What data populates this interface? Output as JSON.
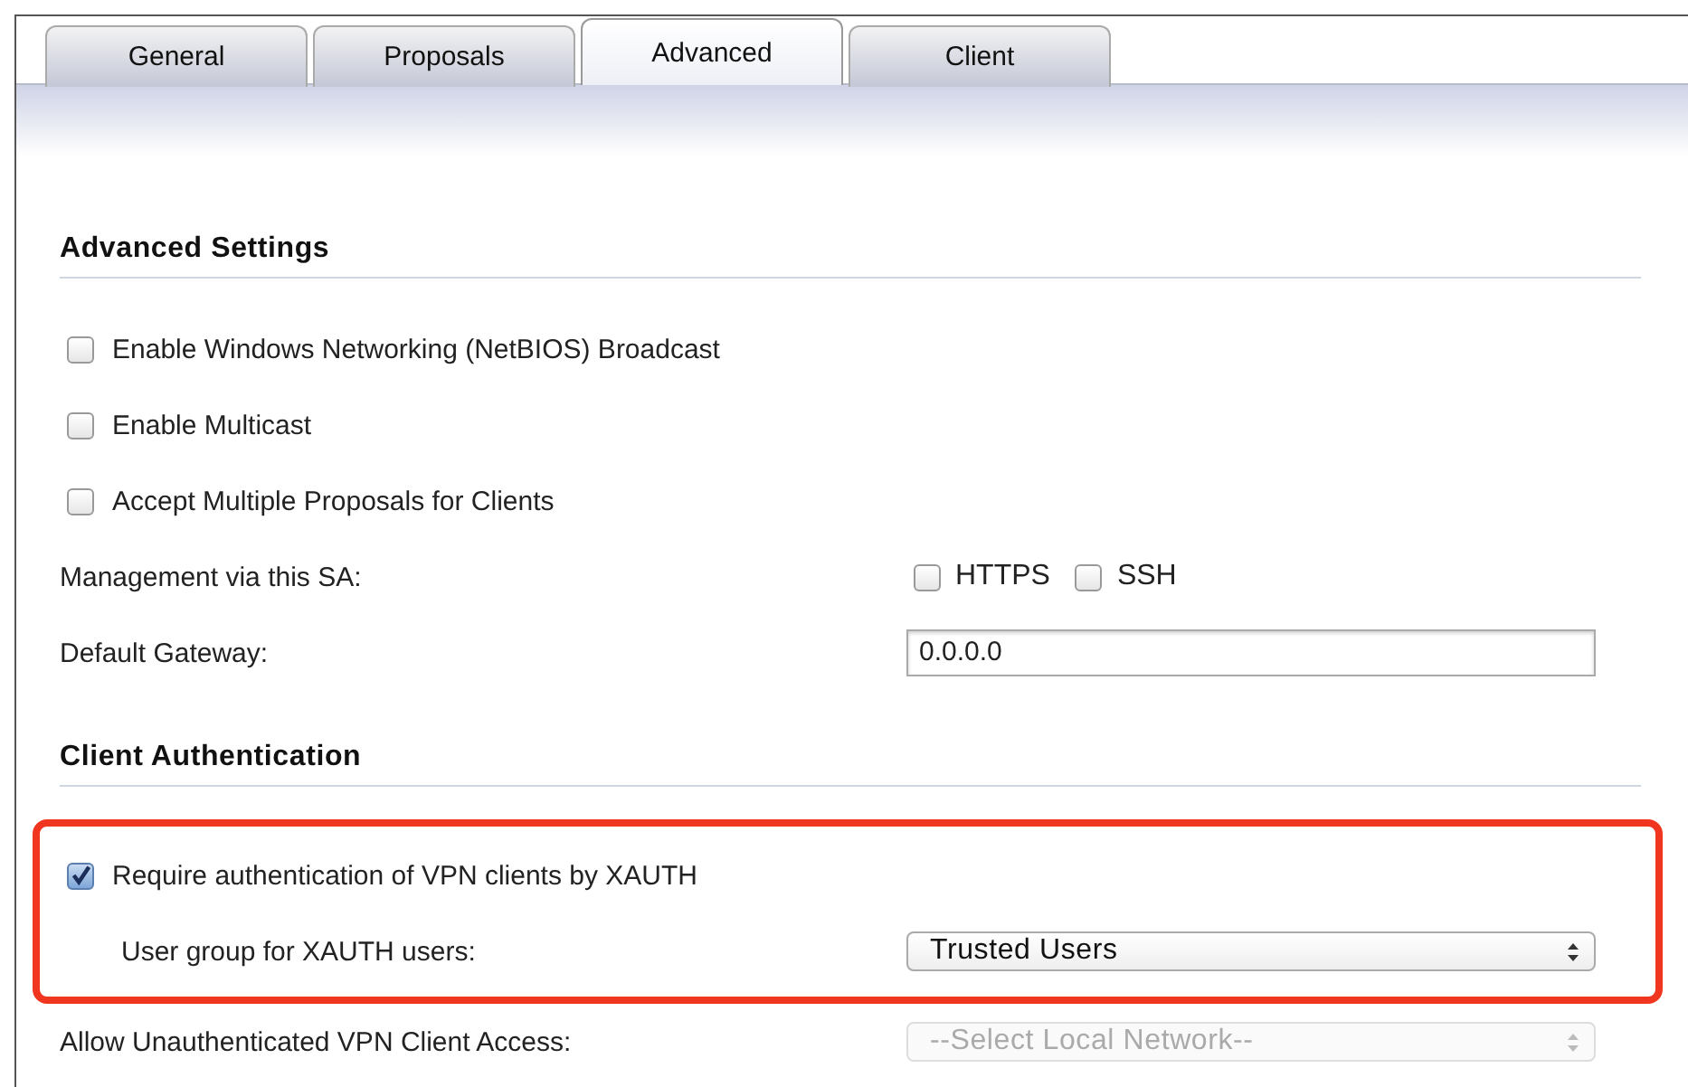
{
  "tabs": [
    {
      "label": "General",
      "selected": false
    },
    {
      "label": "Proposals",
      "selected": false
    },
    {
      "label": "Advanced",
      "selected": true
    },
    {
      "label": "Client",
      "selected": false
    }
  ],
  "sections": [
    {
      "title": "Advanced Settings",
      "rows": [
        {
          "kind": "checkbox",
          "label": "Enable Windows Networking (NetBIOS) Broadcast",
          "checked": false
        },
        {
          "kind": "checkbox",
          "label": "Enable Multicast",
          "checked": false
        },
        {
          "kind": "checkbox",
          "label": "Accept Multiple Proposals for Clients",
          "checked": false
        },
        {
          "kind": "checkboxes",
          "label": "Management via this SA:",
          "options": [
            {
              "label": "HTTPS",
              "checked": false
            },
            {
              "label": "SSH",
              "checked": false
            }
          ]
        },
        {
          "kind": "text",
          "label": "Default Gateway:",
          "value": "0.0.0.0"
        }
      ]
    },
    {
      "title": "Client Authentication",
      "rows": [
        {
          "kind": "checkbox",
          "label": "Require authentication of VPN clients by XAUTH",
          "checked": true,
          "highlighted": true,
          "children": [
            {
              "kind": "select",
              "label": "User group for XAUTH users:",
              "value": "Trusted Users",
              "disabled": false
            }
          ]
        },
        {
          "kind": "select",
          "label": "Allow Unauthenticated VPN Client Access:",
          "value": "--Select Local Network--",
          "disabled": true
        }
      ]
    }
  ]
}
